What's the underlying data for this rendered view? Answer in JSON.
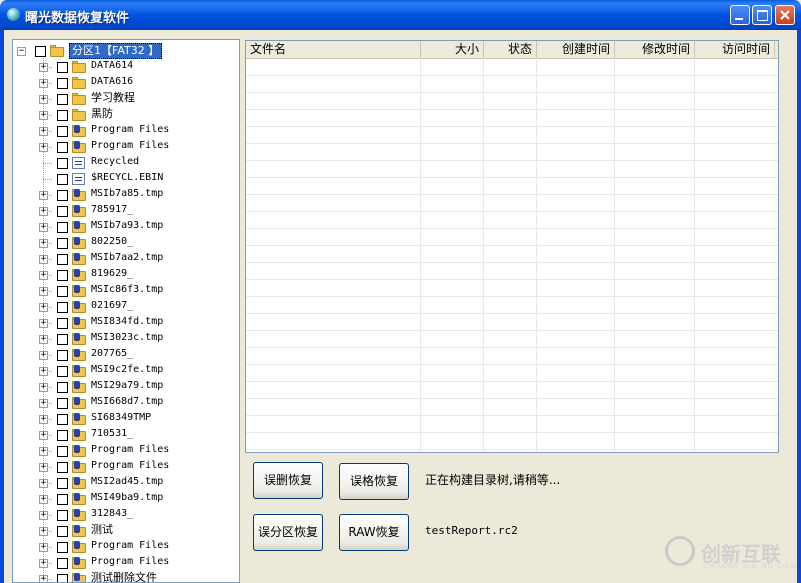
{
  "window": {
    "title": "曙光数据恢复软件"
  },
  "tree": {
    "items": [
      {
        "label": "分区1【FAT32 】",
        "icon": "folder-icon",
        "level": 0,
        "expander": "-",
        "selected": true
      },
      {
        "label": "DATA614",
        "icon": "folder-icon",
        "level": 1,
        "expander": "+"
      },
      {
        "label": "DATA616",
        "icon": "folder-icon",
        "level": 1,
        "expander": "+"
      },
      {
        "label": "学习教程",
        "icon": "folder-icon",
        "level": 1,
        "expander": "+"
      },
      {
        "label": "黑防",
        "icon": "folder-icon",
        "level": 1,
        "expander": "+"
      },
      {
        "label": "Program Files",
        "icon": "deleted-folder-icon",
        "level": 1,
        "expander": "+"
      },
      {
        "label": "Program Files",
        "icon": "deleted-folder-icon",
        "level": 1,
        "expander": "+"
      },
      {
        "label": "Recycled",
        "icon": "file-icon",
        "level": 1,
        "expander": ""
      },
      {
        "label": "$RECYCL.EBIN",
        "icon": "file-icon",
        "level": 1,
        "expander": ""
      },
      {
        "label": "MSIb7a85.tmp",
        "icon": "deleted-folder-icon",
        "level": 1,
        "expander": "+"
      },
      {
        "label": "785917_",
        "icon": "deleted-folder-icon",
        "level": 1,
        "expander": "+"
      },
      {
        "label": "MSIb7a93.tmp",
        "icon": "deleted-folder-icon",
        "level": 1,
        "expander": "+"
      },
      {
        "label": "802250_",
        "icon": "deleted-folder-icon",
        "level": 1,
        "expander": "+"
      },
      {
        "label": "MSIb7aa2.tmp",
        "icon": "deleted-folder-icon",
        "level": 1,
        "expander": "+"
      },
      {
        "label": "819629_",
        "icon": "deleted-folder-icon",
        "level": 1,
        "expander": "+"
      },
      {
        "label": "MSIc86f3.tmp",
        "icon": "deleted-folder-icon",
        "level": 1,
        "expander": "+"
      },
      {
        "label": "021697_",
        "icon": "deleted-folder-icon",
        "level": 1,
        "expander": "+"
      },
      {
        "label": "MSI834fd.tmp",
        "icon": "deleted-folder-icon",
        "level": 1,
        "expander": "+"
      },
      {
        "label": "MSI3023c.tmp",
        "icon": "deleted-folder-icon",
        "level": 1,
        "expander": "+"
      },
      {
        "label": "207765_",
        "icon": "deleted-folder-icon",
        "level": 1,
        "expander": "+"
      },
      {
        "label": "MSI9c2fe.tmp",
        "icon": "deleted-folder-icon",
        "level": 1,
        "expander": "+"
      },
      {
        "label": "MSI29a79.tmp",
        "icon": "deleted-folder-icon",
        "level": 1,
        "expander": "+"
      },
      {
        "label": "MSI668d7.tmp",
        "icon": "deleted-folder-icon",
        "level": 1,
        "expander": "+"
      },
      {
        "label": "SI68349TMP",
        "icon": "deleted-folder-icon",
        "level": 1,
        "expander": "+"
      },
      {
        "label": "710531_",
        "icon": "deleted-folder-icon",
        "level": 1,
        "expander": "+"
      },
      {
        "label": "Program Files",
        "icon": "deleted-folder-icon",
        "level": 1,
        "expander": "+"
      },
      {
        "label": "Program Files",
        "icon": "deleted-folder-icon",
        "level": 1,
        "expander": "+"
      },
      {
        "label": "MSI2ad45.tmp",
        "icon": "deleted-folder-icon",
        "level": 1,
        "expander": "+"
      },
      {
        "label": "MSI49ba9.tmp",
        "icon": "deleted-folder-icon",
        "level": 1,
        "expander": "+"
      },
      {
        "label": "312843_",
        "icon": "deleted-folder-icon",
        "level": 1,
        "expander": "+"
      },
      {
        "label": "测试",
        "icon": "deleted-folder-icon",
        "level": 1,
        "expander": "+"
      },
      {
        "label": "Program Files",
        "icon": "deleted-folder-icon",
        "level": 1,
        "expander": "+"
      },
      {
        "label": "Program Files",
        "icon": "deleted-folder-icon",
        "level": 1,
        "expander": "+"
      },
      {
        "label": "测试删除文件",
        "icon": "deleted-folder-icon",
        "level": 1,
        "expander": "+"
      }
    ]
  },
  "file_list": {
    "columns": [
      "文件名",
      "大小",
      "状态",
      "创建时间",
      "修改时间",
      "访问时间"
    ],
    "rows": []
  },
  "actions": {
    "deleted_recovery": "误删恢复",
    "format_recovery": "误格恢复",
    "partition_recovery": "误分区恢复",
    "raw_recovery": "RAW恢复"
  },
  "status": {
    "message": "正在构建目录树,请稍等...",
    "report_file": "testReport.rc2"
  },
  "watermark": {
    "brand": "创新互联",
    "sub": "CHUANG XIN HU LIAN"
  }
}
